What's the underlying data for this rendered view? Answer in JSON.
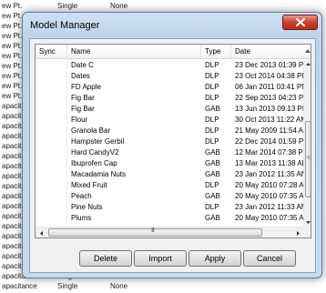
{
  "background": {
    "rows": [
      {
        "c0": "ew Pt.",
        "c1": "Single",
        "c2": "None"
      },
      {
        "c0": "ew Pt.",
        "c1": "",
        "c2": ""
      },
      {
        "c0": "ew Pt.",
        "c1": "",
        "c2": ""
      },
      {
        "c0": "ew Pt.",
        "c1": "",
        "c2": ""
      },
      {
        "c0": "ew Pt.",
        "c1": "",
        "c2": ""
      },
      {
        "c0": "ew Pt.",
        "c1": "",
        "c2": ""
      },
      {
        "c0": "ew Pt.",
        "c1": "",
        "c2": ""
      },
      {
        "c0": "ew Pt.",
        "c1": "",
        "c2": ""
      },
      {
        "c0": "ew Pt.",
        "c1": "",
        "c2": ""
      },
      {
        "c0": "ew Pt.",
        "c1": "",
        "c2": ""
      },
      {
        "c0": "apacita",
        "c1": "",
        "c2": ""
      },
      {
        "c0": "apacita",
        "c1": "",
        "c2": ""
      },
      {
        "c0": "apacita",
        "c1": "",
        "c2": ""
      },
      {
        "c0": "apacita",
        "c1": "",
        "c2": ""
      },
      {
        "c0": "apacita",
        "c1": "",
        "c2": ""
      },
      {
        "c0": "apacita",
        "c1": "",
        "c2": ""
      },
      {
        "c0": "apacita",
        "c1": "",
        "c2": ""
      },
      {
        "c0": "apacita",
        "c1": "",
        "c2": ""
      },
      {
        "c0": "apacita",
        "c1": "",
        "c2": ""
      },
      {
        "c0": "apacita",
        "c1": "",
        "c2": ""
      },
      {
        "c0": "apacita",
        "c1": "",
        "c2": ""
      },
      {
        "c0": "apacita",
        "c1": "",
        "c2": ""
      },
      {
        "c0": "apacita",
        "c1": "",
        "c2": ""
      },
      {
        "c0": "apacita",
        "c1": "",
        "c2": ""
      },
      {
        "c0": "apacita",
        "c1": "",
        "c2": ""
      },
      {
        "c0": "apacita",
        "c1": "",
        "c2": ""
      },
      {
        "c0": "apacita",
        "c1": "",
        "c2": ""
      },
      {
        "c0": "apacitance",
        "c1": "Single",
        "c2": "None"
      },
      {
        "c0": "apacitance",
        "c1": "Single",
        "c2": "None"
      }
    ]
  },
  "dialog": {
    "title": "Model Manager",
    "close_icon": "close-x-icon",
    "columns": {
      "sync": "Sync",
      "name": "Name",
      "type": "Type",
      "date": "Date"
    },
    "rows": [
      {
        "name": "Date C",
        "type": "DLP",
        "date": "23 Dec 2013 01:39 PM"
      },
      {
        "name": "Dates",
        "type": "DLP",
        "date": "23 Oct 2014 04:38 PM"
      },
      {
        "name": "FD Apple",
        "type": "DLP",
        "date": "06 Jan 2011 03:41 PM"
      },
      {
        "name": "Fig Bar",
        "type": "DLP",
        "date": "22 Sep 2013 04:23 PM"
      },
      {
        "name": "Fig Bar",
        "type": "GAB",
        "date": "13 Jun 2013 09:13 PM"
      },
      {
        "name": "Flour",
        "type": "DLP",
        "date": "30 Oct 2013 11:22 AM"
      },
      {
        "name": "Granola Bar",
        "type": "DLP",
        "date": "21 May 2009 11:54 AM"
      },
      {
        "name": "Hampster Gerbil",
        "type": "DLP",
        "date": "22 Dec 2014 01:59 PM"
      },
      {
        "name": "Hard CandyV2",
        "type": "GAB",
        "date": "12 Mar 2014 07:38 PM"
      },
      {
        "name": "Ibuprofen Cap",
        "type": "GAB",
        "date": "13 Mar 2013 11:38 AM"
      },
      {
        "name": "Macadamia Nuts",
        "type": "GAB",
        "date": "23 Jan 2012 11:35 AM"
      },
      {
        "name": "Mixed Fruit",
        "type": "DLP",
        "date": "20 May 2010 07:28 AM"
      },
      {
        "name": "Peach",
        "type": "GAB",
        "date": "20 May 2010 07:35 AM"
      },
      {
        "name": "Pine Nuts",
        "type": "DLP",
        "date": "23 Jan 2012 11:33 AM"
      },
      {
        "name": "Plums",
        "type": "GAB",
        "date": "20 May 2010 07:35 AM"
      }
    ],
    "hscroll_grip": "III",
    "vscroll_grip": "≡",
    "buttons": {
      "delete": "Delete",
      "import": "Import",
      "apply": "Apply",
      "cancel": "Cancel"
    }
  }
}
